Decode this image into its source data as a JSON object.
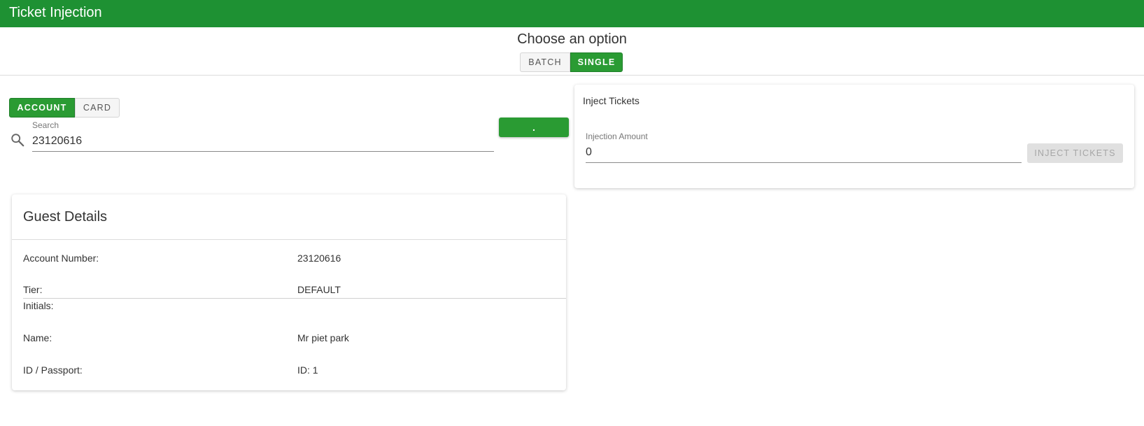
{
  "appbar": {
    "title": "Ticket Injection"
  },
  "mode": {
    "heading": "Choose an option",
    "options": [
      "BATCH",
      "SINGLE"
    ],
    "selected": "SINGLE"
  },
  "search": {
    "types": [
      "ACCOUNT",
      "CARD"
    ],
    "selected_type": "ACCOUNT",
    "label": "Search",
    "value": "23120616",
    "button_label": "."
  },
  "inject": {
    "title": "Inject Tickets",
    "amount_label": "Injection Amount",
    "amount_value": "0",
    "button_label": "INJECT TICKETS"
  },
  "guest": {
    "title": "Guest Details",
    "rows": [
      {
        "label": "Account Number:",
        "value": "23120616"
      },
      {
        "label": "Tier:",
        "value": "DEFAULT"
      },
      {
        "label": "Initials:",
        "value": ""
      },
      {
        "label": "Name:",
        "value": "Mr piet park"
      },
      {
        "label": "ID / Passport:",
        "value": "ID: 1"
      }
    ]
  },
  "colors": {
    "primary": "#1e9133",
    "button_green": "#2a9b33",
    "disabled": "#e0e0e0"
  },
  "icons": {
    "search": "search-icon"
  }
}
